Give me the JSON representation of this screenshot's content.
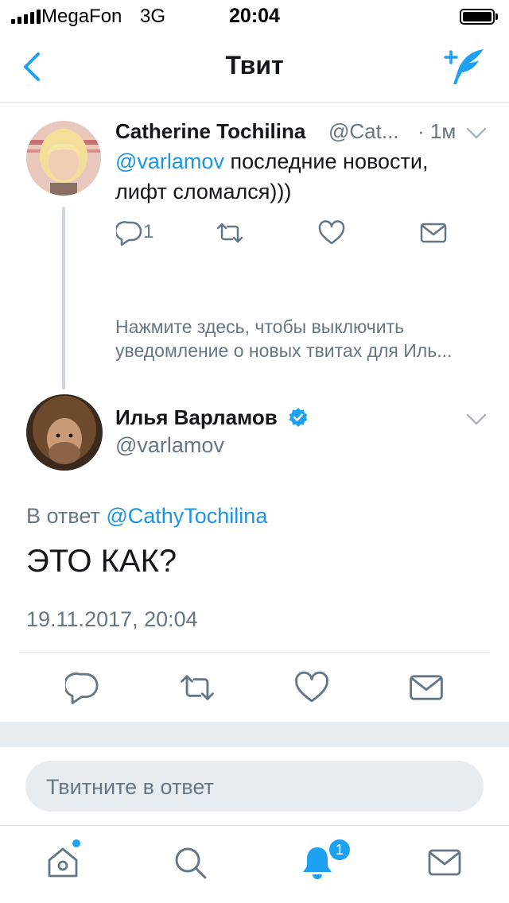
{
  "status_bar": {
    "carrier": "MegaFon",
    "network": "3G",
    "time": "20:04"
  },
  "nav": {
    "title": "Твит"
  },
  "parent_tweet": {
    "author_name": "Catherine Tochilina",
    "author_handle": "@Cat...",
    "time_ago": "· 1м",
    "mention": "@varlamov",
    "text_line1_rest": " последние новости,",
    "text_line2": "лифт сломался)))",
    "reply_count": "1",
    "mute_notice_line1": "Нажмите здесь, чтобы выключить",
    "mute_notice_line2": "уведомление о новых твитах для Иль..."
  },
  "main_tweet": {
    "author_name": "Илья Варламов",
    "author_handle": "@varlamov",
    "reply_prefix": "В ответ ",
    "reply_to": "@CathyTochilina",
    "text": "ЭТО КАК?",
    "timestamp": "19.11.2017, 20:04"
  },
  "composer": {
    "placeholder": "Твитните в ответ"
  },
  "tab_bar": {
    "notifications_badge": "1"
  },
  "colors": {
    "accent": "#1da1f2",
    "link": "#1b95e0",
    "muted": "#657786",
    "separator": "#e6ecf0"
  },
  "icons": [
    "back-icon",
    "compose-tweet-icon",
    "chevron-down-icon",
    "reply-icon",
    "retweet-icon",
    "like-icon",
    "direct-message-icon",
    "home-icon",
    "search-icon",
    "notifications-icon",
    "messages-icon",
    "verified-icon"
  ]
}
